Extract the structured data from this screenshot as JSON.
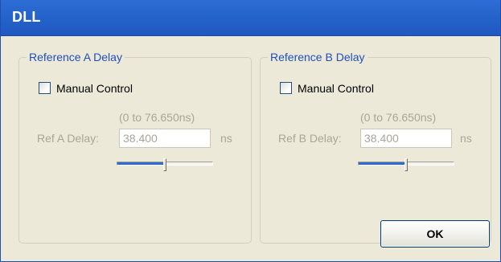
{
  "window": {
    "title": "DLL"
  },
  "group_a": {
    "legend": "Reference A Delay",
    "checkbox_label": "Manual Control",
    "checked": false,
    "range_label": "(0 to 76.650ns)",
    "field_label": "Ref A Delay:",
    "value": "38.400",
    "unit": "ns",
    "slider_level": 0.5
  },
  "group_b": {
    "legend": "Reference B Delay",
    "checkbox_label": "Manual Control",
    "checked": false,
    "range_label": "(0 to 76.650ns)",
    "field_label": "Ref B Delay:",
    "value": "38.400",
    "unit": "ns",
    "slider_level": 0.5
  },
  "buttons": {
    "ok_label": "OK"
  },
  "colors": {
    "titlebar": "#2565cc",
    "legend_text": "#1f4fbd",
    "disabled_text": "#a7a69a",
    "slider_fill": "#2c6bd6"
  }
}
